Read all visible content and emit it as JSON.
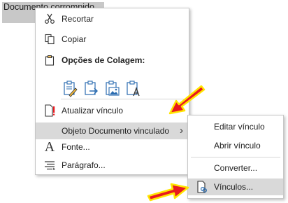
{
  "document": {
    "selected_text": "Documento corrompido"
  },
  "context_menu": {
    "items": {
      "cut": {
        "label": "Recortar",
        "icon": "scissors-icon"
      },
      "copy": {
        "label": "Copiar",
        "icon": "copy-icon"
      },
      "paste_header": {
        "label": "Opções de Colagem:",
        "icon": "clipboard-icon"
      },
      "update_link": {
        "label": "Atualizar vínculo",
        "icon": "update-link-icon"
      },
      "linked_object": {
        "label": "Objeto Documento vinculado",
        "submenu_arrow": "›"
      },
      "font": {
        "label": "Fonte...",
        "icon": "font-icon",
        "glyph": "A"
      },
      "paragraph": {
        "label": "Parágrafo...",
        "icon": "paragraph-icon"
      }
    },
    "paste_options": [
      {
        "name": "paste-keep-source-formatting"
      },
      {
        "name": "paste-merge-formatting"
      },
      {
        "name": "paste-picture"
      },
      {
        "name": "paste-keep-text-only"
      }
    ]
  },
  "submenu": {
    "items": {
      "edit_link": {
        "label": "Editar vínculo"
      },
      "open_link": {
        "label": "Abrir vínculo"
      },
      "convert": {
        "label": "Converter..."
      },
      "links": {
        "label": "Vínculos...",
        "icon": "links-icon"
      }
    }
  },
  "colors": {
    "highlight": "#d9d9d9",
    "selection": "#c8c8c8",
    "icon_blue": "#2b6cb0",
    "arrow_red": "#e8191f",
    "arrow_yellow": "#ffe500"
  }
}
